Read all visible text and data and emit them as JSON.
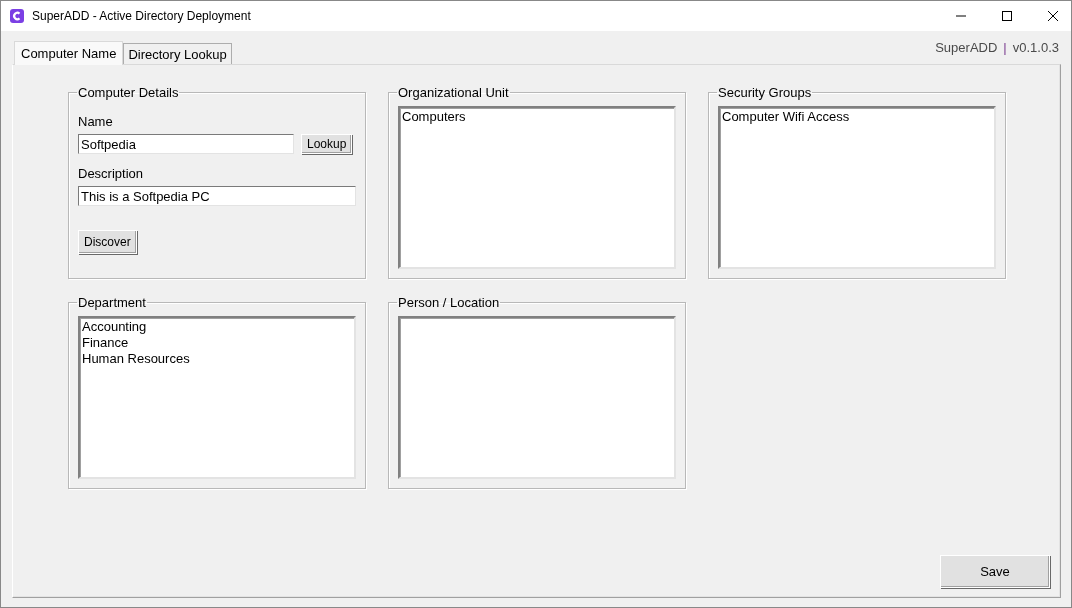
{
  "window": {
    "title": "SuperADD - Active Directory Deployment"
  },
  "tabs": [
    {
      "label": "Computer Name",
      "selected": true
    },
    {
      "label": "Directory Lookup",
      "selected": false
    }
  ],
  "version_label": {
    "app": "SuperADD",
    "separator": "|",
    "version": "v0.1.0.3"
  },
  "computer_details": {
    "title": "Computer Details",
    "name_label": "Name",
    "name_value": "Softpedia",
    "lookup_button": "Lookup",
    "description_label": "Description",
    "description_value": "This is a Softpedia PC",
    "discover_button": "Discover"
  },
  "lists": [
    {
      "title": "Organizational Unit",
      "items": [
        "Computers"
      ]
    },
    {
      "title": "Security Groups",
      "items": [
        "Computer Wifi Access"
      ]
    },
    {
      "title": "Department",
      "items": [
        "Accounting",
        "Finance",
        "Human Resources"
      ]
    },
    {
      "title": "Person / Location"
    }
  ],
  "save_button": "Save"
}
